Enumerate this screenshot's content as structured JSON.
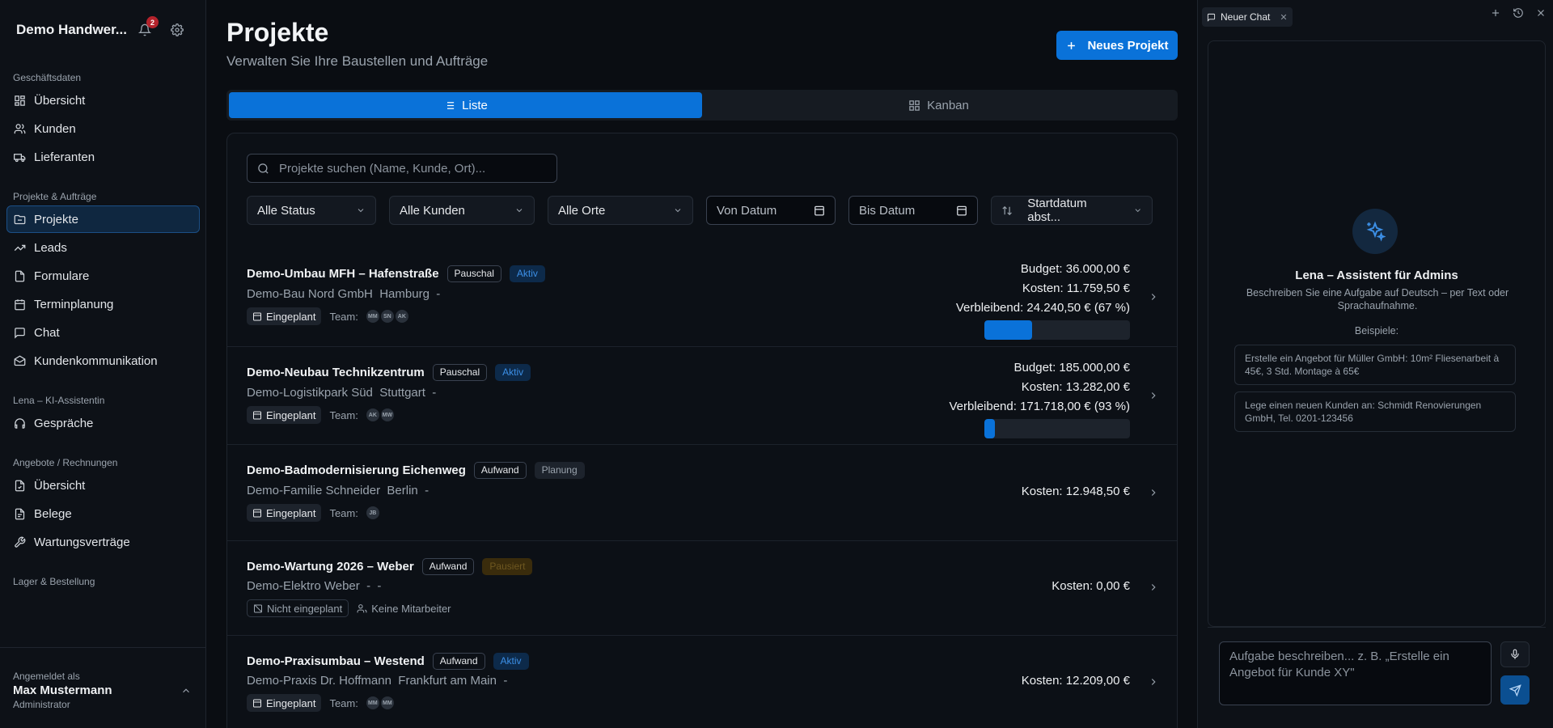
{
  "sidebar": {
    "company": "Demo Handwer...",
    "notification_count": "2",
    "sections": [
      {
        "title": "Geschäftsdaten",
        "items": [
          {
            "label": "Übersicht",
            "icon": "dashboard-icon"
          },
          {
            "label": "Kunden",
            "icon": "users-icon"
          },
          {
            "label": "Lieferanten",
            "icon": "truck-icon"
          }
        ]
      },
      {
        "title": "Projekte & Aufträge",
        "items": [
          {
            "label": "Projekte",
            "icon": "folder-icon",
            "active": true
          },
          {
            "label": "Leads",
            "icon": "trending-up-icon"
          },
          {
            "label": "Formulare",
            "icon": "file-icon"
          },
          {
            "label": "Terminplanung",
            "icon": "calendar-icon"
          },
          {
            "label": "Chat",
            "icon": "message-icon"
          },
          {
            "label": "Kundenkommunikation",
            "icon": "mail-icon"
          }
        ]
      },
      {
        "title": "Lena – KI-Assistentin",
        "items": [
          {
            "label": "Gespräche",
            "icon": "headphones-icon"
          }
        ]
      },
      {
        "title": "Angebote / Rechnungen",
        "items": [
          {
            "label": "Übersicht",
            "icon": "file-check-icon"
          },
          {
            "label": "Belege",
            "icon": "receipt-icon"
          },
          {
            "label": "Wartungsverträge",
            "icon": "wrench-icon"
          }
        ]
      },
      {
        "title": "Lager & Bestellung",
        "items": []
      }
    ],
    "footer": {
      "label": "Angemeldet als",
      "name": "Max Mustermann",
      "role": "Administrator"
    }
  },
  "main": {
    "title": "Projekte",
    "subtitle": "Verwalten Sie Ihre Baustellen und Aufträge",
    "new_button": "Neues Projekt",
    "tabs": [
      {
        "label": "Liste",
        "active": true
      },
      {
        "label": "Kanban",
        "active": false
      }
    ],
    "search_placeholder": "Projekte suchen (Name, Kunde, Ort)...",
    "filters": {
      "status": "Alle Status",
      "kunden": "Alle Kunden",
      "orte": "Alle Orte",
      "von": "Von Datum",
      "bis": "Bis Datum",
      "sort": "Startdatum abst..."
    },
    "projects": [
      {
        "name": "Demo-Umbau MFH – Hafenstraße",
        "type": "Pauschal",
        "status": "Aktiv",
        "status_kind": "aktiv",
        "client": "Demo-Bau Nord GmbH  Hamburg  -",
        "planning": "Eingeplant",
        "planned": true,
        "team_label": "Team:",
        "team": [
          "MM",
          "SN",
          "AK"
        ],
        "budget": "Budget: 36.000,00 €",
        "kosten": "Kosten: 11.759,50 €",
        "verbleibend": "Verbleibend: 24.240,50 € (67 %)",
        "used_fraction": 0.33
      },
      {
        "name": "Demo-Neubau Technikzentrum",
        "type": "Pauschal",
        "status": "Aktiv",
        "status_kind": "aktiv",
        "client": "Demo-Logistikpark Süd  Stuttgart  -",
        "planning": "Eingeplant",
        "planned": true,
        "team_label": "Team:",
        "team": [
          "AK",
          "MW"
        ],
        "budget": "Budget: 185.000,00 €",
        "kosten": "Kosten: 13.282,00 €",
        "verbleibend": "Verbleibend: 171.718,00 € (93 %)",
        "used_fraction": 0.07
      },
      {
        "name": "Demo-Badmodernisierung Eichenweg",
        "type": "Aufwand",
        "status": "Planung",
        "status_kind": "planung",
        "client": "Demo-Familie Schneider  Berlin  -",
        "planning": "Eingeplant",
        "planned": true,
        "team_label": "Team:",
        "team": [
          "JB"
        ],
        "kosten": "Kosten: 12.948,50 €"
      },
      {
        "name": "Demo-Wartung 2026 – Weber",
        "type": "Aufwand",
        "status": "Pausiert",
        "status_kind": "pausiert",
        "client": "Demo-Elektro Weber  -  -",
        "planning": "Nicht eingeplant",
        "planned": false,
        "no_team": "Keine Mitarbeiter",
        "kosten": "Kosten: 0,00 €"
      },
      {
        "name": "Demo-Praxisumbau – Westend",
        "type": "Aufwand",
        "status": "Aktiv",
        "status_kind": "aktiv",
        "client": "Demo-Praxis Dr. Hoffmann  Frankfurt am Main  -",
        "planning": "Eingeplant",
        "planned": true,
        "team_label": "Team:",
        "team": [
          "MM",
          "MM"
        ],
        "kosten": "Kosten: 12.209,00 €"
      }
    ]
  },
  "chat": {
    "tab_label": "Neuer Chat",
    "assistant_title": "Lena – Assistent für Admins",
    "assistant_desc": "Beschreiben Sie eine Aufgabe auf Deutsch – per Text oder Sprachaufnahme.",
    "examples_label": "Beispiele:",
    "examples": [
      "Erstelle ein Angebot für Müller GmbH: 10m² Fliesenarbeit à 45€, 3 Std. Montage à 65€",
      "Lege einen neuen Kunden an: Schmidt Renovierungen GmbH, Tel. 0201-123456"
    ],
    "input_placeholder": "Aufgabe beschreiben... z. B. „Erstelle ein Angebot für Kunde XY\""
  }
}
